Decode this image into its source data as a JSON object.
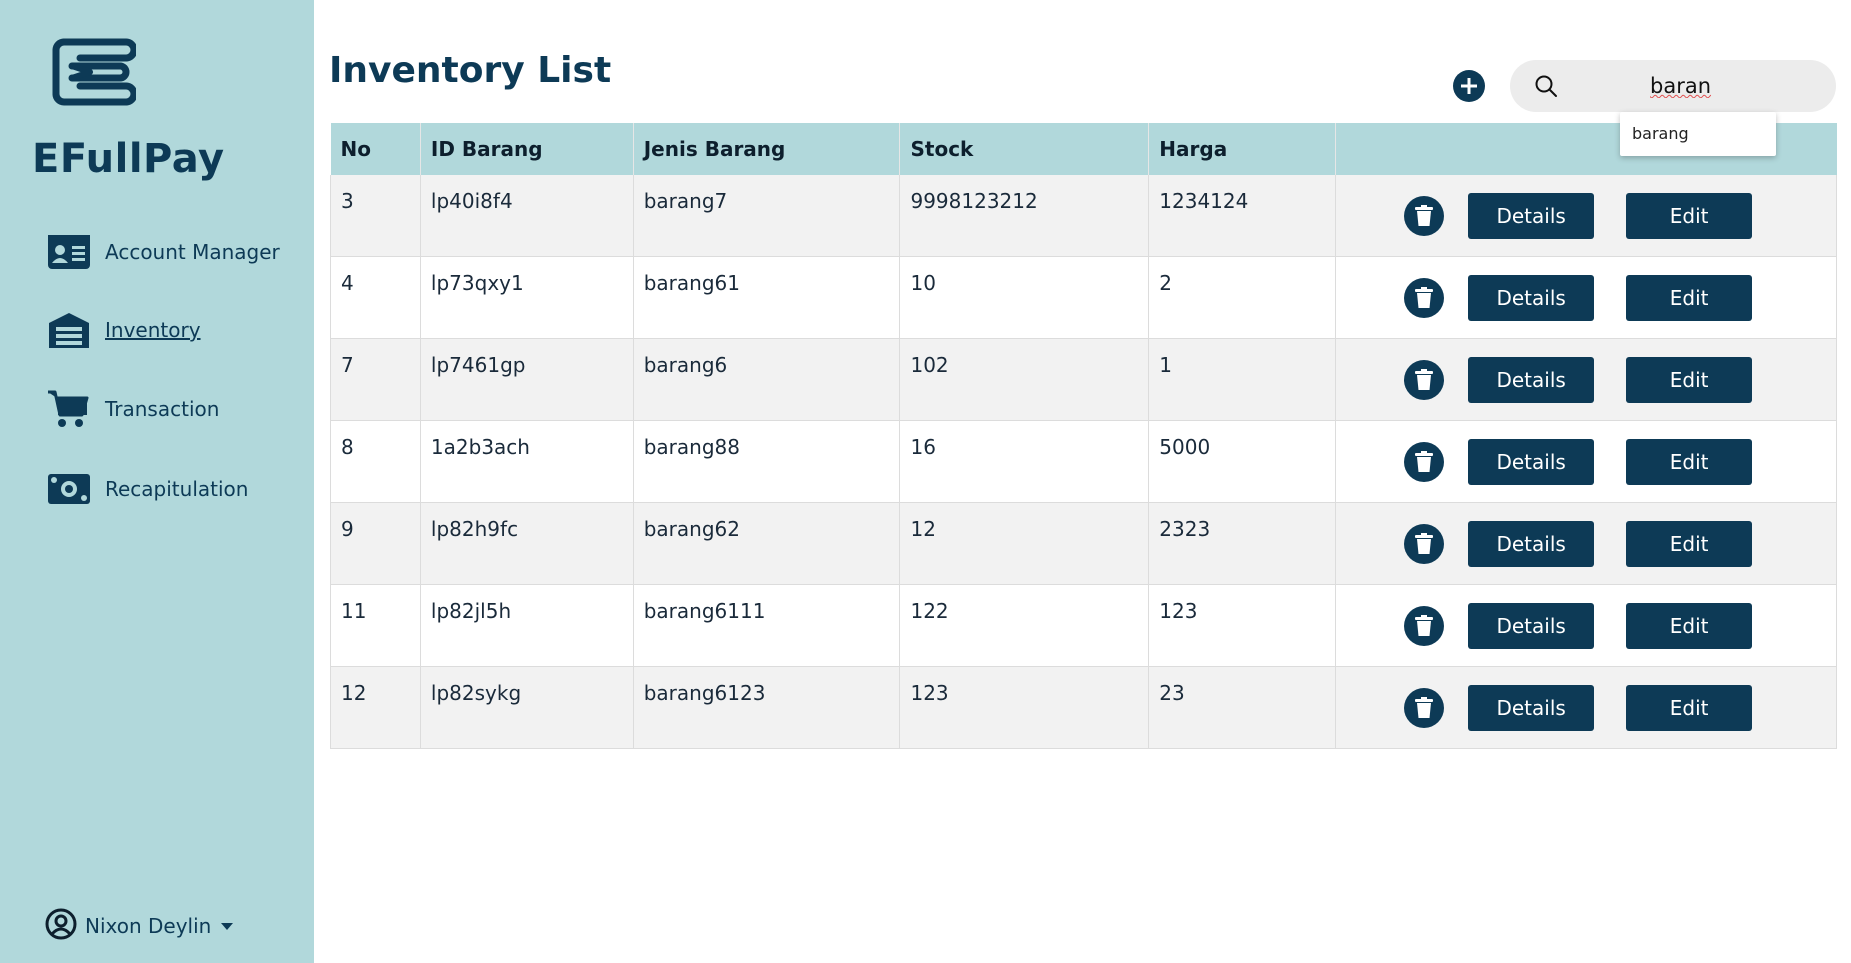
{
  "app": {
    "brand": "EFullPay"
  },
  "sidebar": {
    "items": [
      {
        "label": "Account Manager",
        "icon": "id-card-icon",
        "active": false
      },
      {
        "label": "Inventory",
        "icon": "warehouse-icon",
        "active": true
      },
      {
        "label": "Transaction",
        "icon": "cart-icon",
        "active": false
      },
      {
        "label": "Recapitulation",
        "icon": "money-icon",
        "active": false
      }
    ],
    "user": {
      "name": "Nixon Deylin"
    }
  },
  "page": {
    "title": "Inventory List"
  },
  "search": {
    "value": "baran",
    "suggestions": [
      "barang"
    ]
  },
  "table": {
    "headers": [
      "No",
      "ID Barang",
      "Jenis Barang",
      "Stock",
      "Harga"
    ],
    "rows": [
      {
        "no": "3",
        "id": "lp40i8f4",
        "jenis": "barang7",
        "stock": "9998123212",
        "harga": "1234124"
      },
      {
        "no": "4",
        "id": "lp73qxy1",
        "jenis": "barang61",
        "stock": "10",
        "harga": "2"
      },
      {
        "no": "7",
        "id": "lp7461gp",
        "jenis": "barang6",
        "stock": "102",
        "harga": "1"
      },
      {
        "no": "8",
        "id": "1a2b3ach",
        "jenis": "barang88",
        "stock": "16",
        "harga": "5000"
      },
      {
        "no": "9",
        "id": "lp82h9fc",
        "jenis": "barang62",
        "stock": "12",
        "harga": "2323"
      },
      {
        "no": "11",
        "id": "lp82jl5h",
        "jenis": "barang6111",
        "stock": "122",
        "harga": "123"
      },
      {
        "no": "12",
        "id": "lp82sykg",
        "jenis": "barang6123",
        "stock": "123",
        "harga": "23"
      }
    ],
    "details_label": "Details",
    "edit_label": "Edit"
  },
  "colors": {
    "sidebar_bg": "#b1d8db",
    "primary": "#0d3a56",
    "row_alt": "#f2f2f2"
  }
}
